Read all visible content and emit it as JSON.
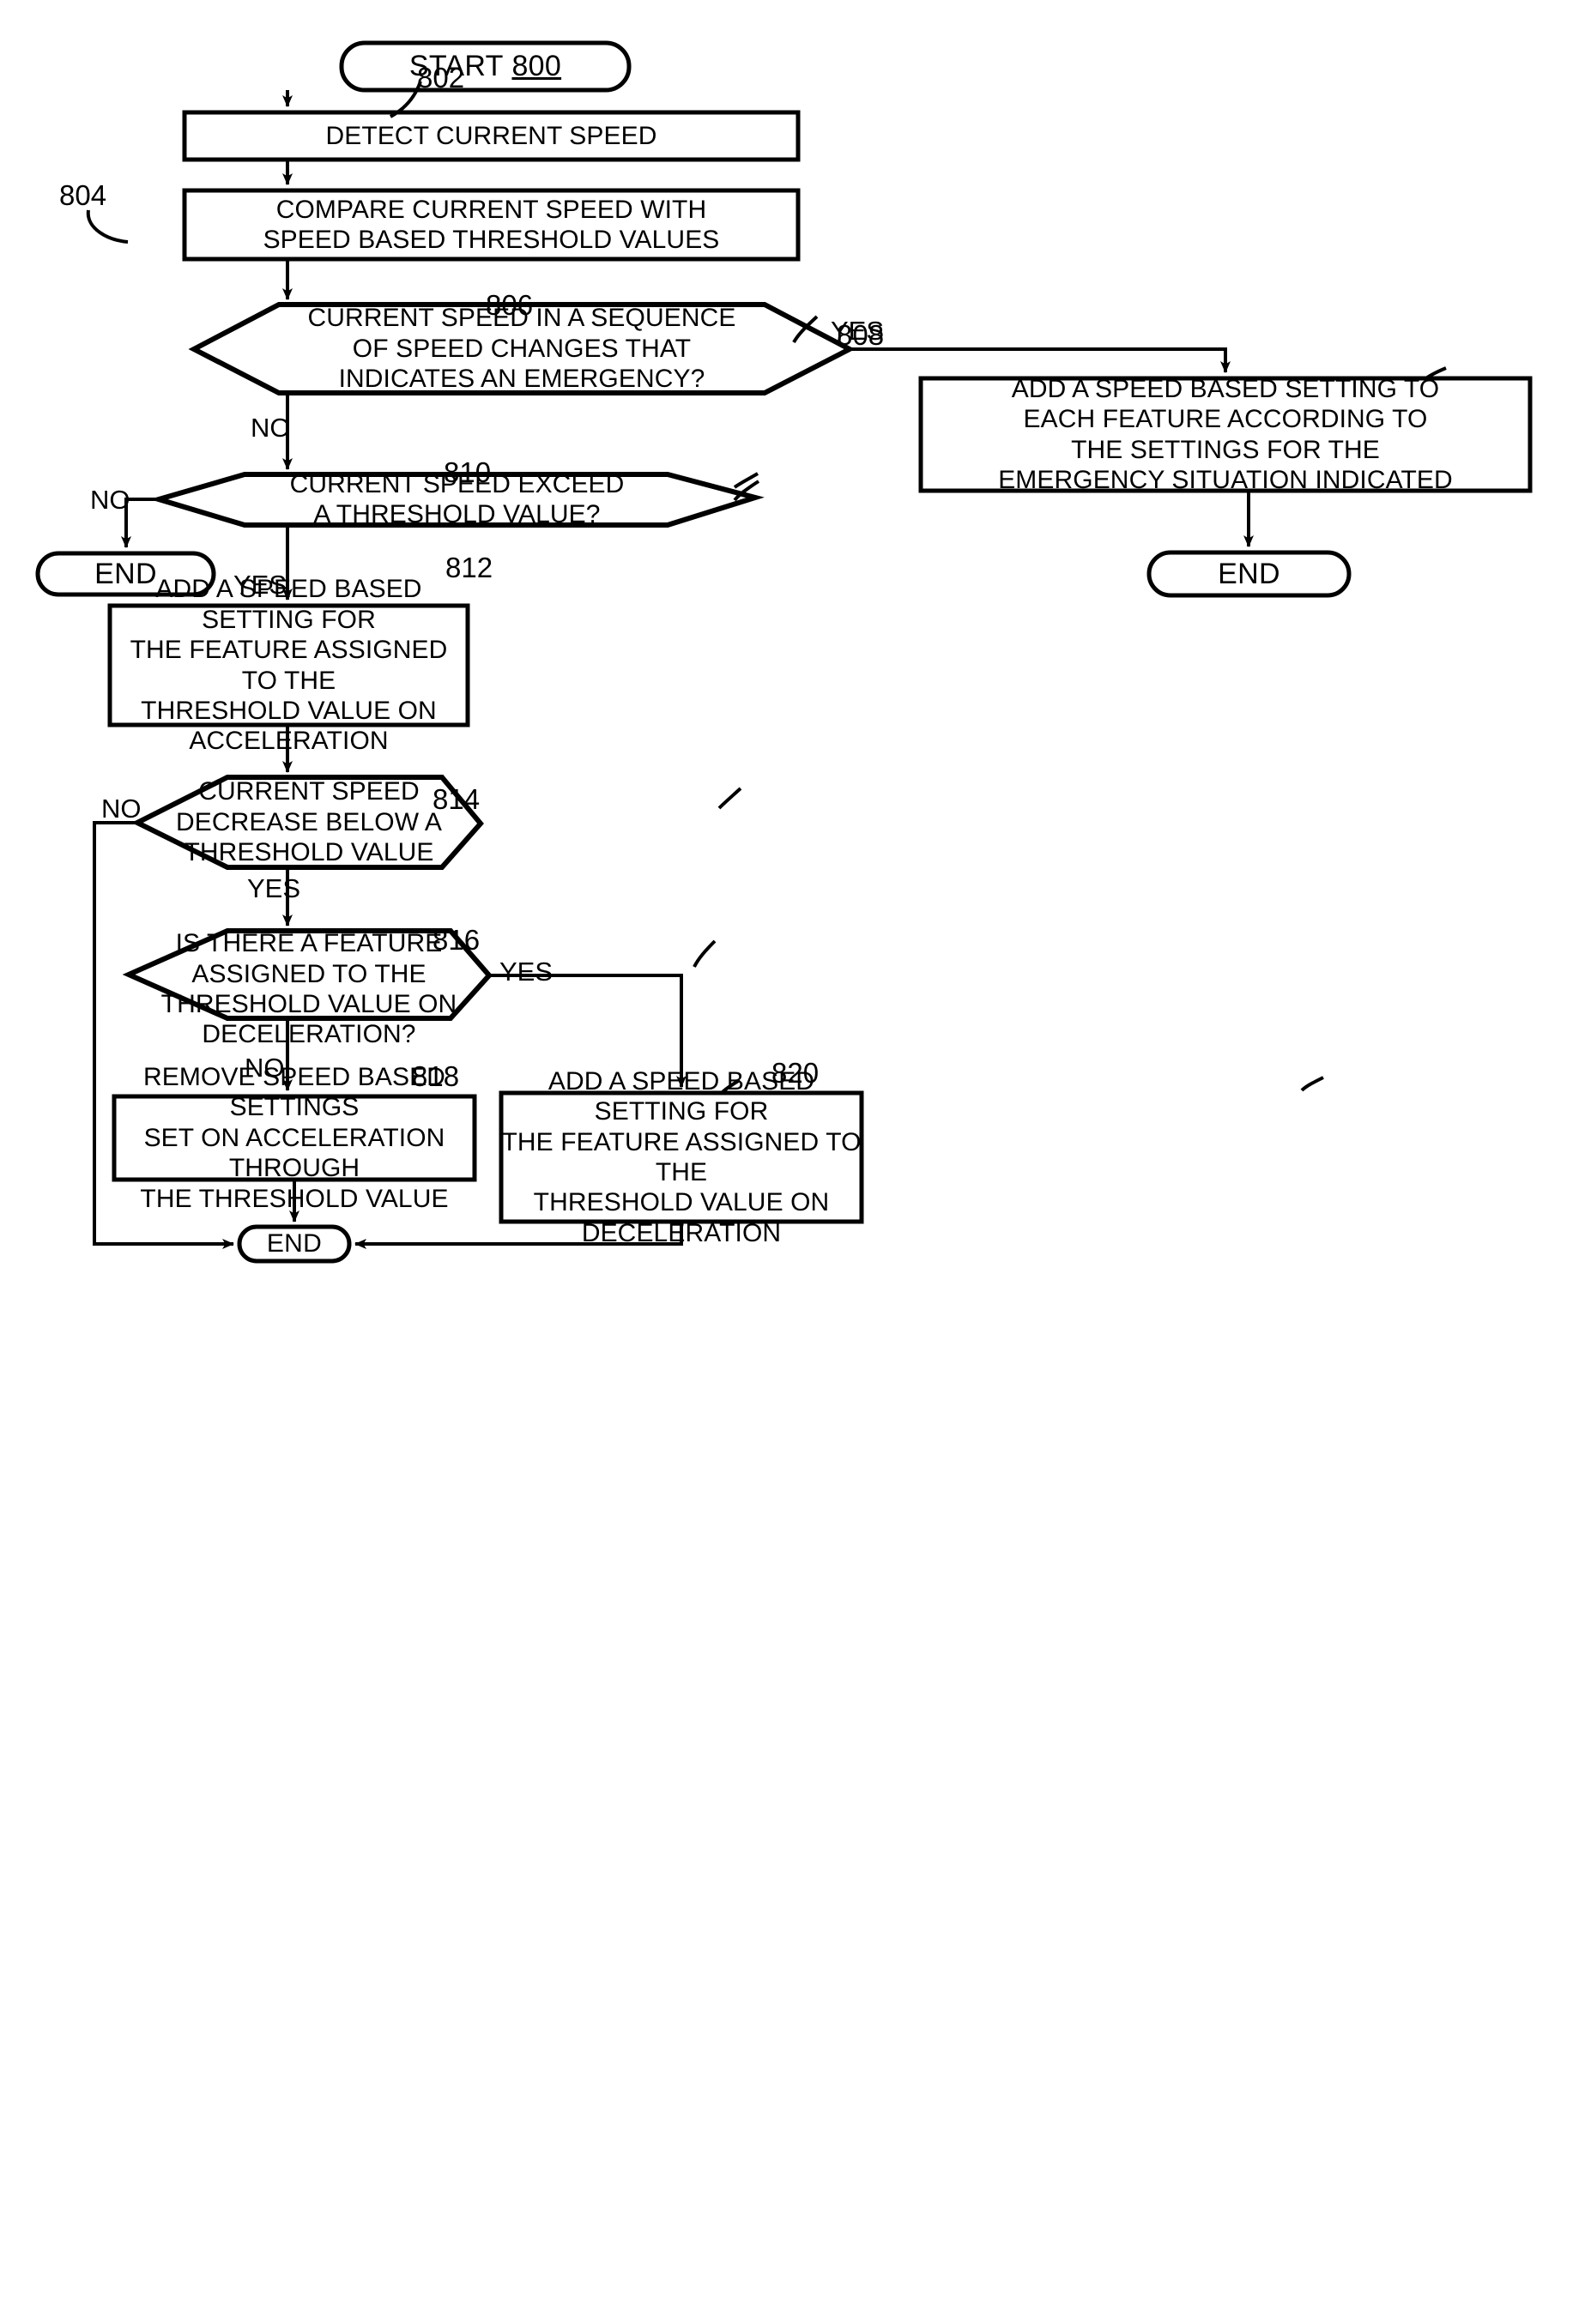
{
  "figure": {
    "type": "flowchart",
    "title": "",
    "start_label": "START",
    "start_ref": "800"
  },
  "nodes": {
    "start": {
      "label": "START",
      "ref": "800",
      "shape": "terminator"
    },
    "detect": {
      "label": "DETECT CURRENT SPEED",
      "ref": "802",
      "shape": "process"
    },
    "compare": {
      "label": "COMPARE CURRENT SPEED WITH\nSPEED BASED THRESHOLD VALUES",
      "ref": "804",
      "shape": "process"
    },
    "emergency": {
      "label": "CURRENT SPEED IN A SEQUENCE\nOF SPEED CHANGES THAT\nINDICATES AN EMERGENCY?",
      "ref": "806",
      "shape": "decision"
    },
    "add_emergency": {
      "label": "ADD A SPEED BASED SETTING TO\nEACH FEATURE ACCORDING TO\nTHE SETTINGS FOR THE\nEMERGENCY SITUATION INDICATED",
      "ref": "808",
      "shape": "process"
    },
    "end_right": {
      "label": "END",
      "ref": "",
      "shape": "terminator"
    },
    "exceed": {
      "label": "CURRENT SPEED EXCEED\nA THRESHOLD VALUE?",
      "ref": "810",
      "shape": "decision"
    },
    "end_left": {
      "label": "END",
      "ref": "",
      "shape": "terminator"
    },
    "add_accel": {
      "label": "ADD A SPEED BASED SETTING FOR\nTHE FEATURE ASSIGNED TO THE\nTHRESHOLD VALUE ON\nACCELERATION",
      "ref": "812",
      "shape": "process"
    },
    "decrease": {
      "label": "CURRENT SPEED\nDECREASE BELOW A\nTHRESHOLD VALUE",
      "ref": "814",
      "shape": "decision"
    },
    "feature_decel": {
      "label": "IS THERE A FEATURE\nASSIGNED TO THE\nTHRESHOLD VALUE ON\nDECELERATION?",
      "ref": "816",
      "shape": "decision"
    },
    "remove": {
      "label": "REMOVE SPEED BASED SETTINGS\nSET ON ACCELERATION THROUGH\nTHE THRESHOLD VALUE",
      "ref": "818",
      "shape": "process"
    },
    "add_decel": {
      "label": "ADD A SPEED BASED SETTING FOR\nTHE FEATURE ASSIGNED TO THE\nTHRESHOLD VALUE ON\nDECELERATION",
      "ref": "820",
      "shape": "process"
    },
    "end_bottom": {
      "label": "END",
      "ref": "",
      "shape": "terminator"
    }
  },
  "edge_labels": {
    "emergency_yes": "YES",
    "emergency_no": "NO",
    "exceed_no": "NO",
    "exceed_yes": "YES",
    "decrease_no": "NO",
    "decrease_yes": "YES",
    "feature_yes": "YES",
    "feature_no": "NO"
  },
  "reference_numerals": {
    "r802": "802",
    "r804": "804",
    "r806": "806",
    "r808": "808",
    "r810": "810",
    "r812": "812",
    "r814": "814",
    "r816": "816",
    "r818": "818",
    "r820": "820"
  },
  "colors": {
    "stroke": "#000000",
    "fill": "#ffffff",
    "background": "#ffffff"
  }
}
